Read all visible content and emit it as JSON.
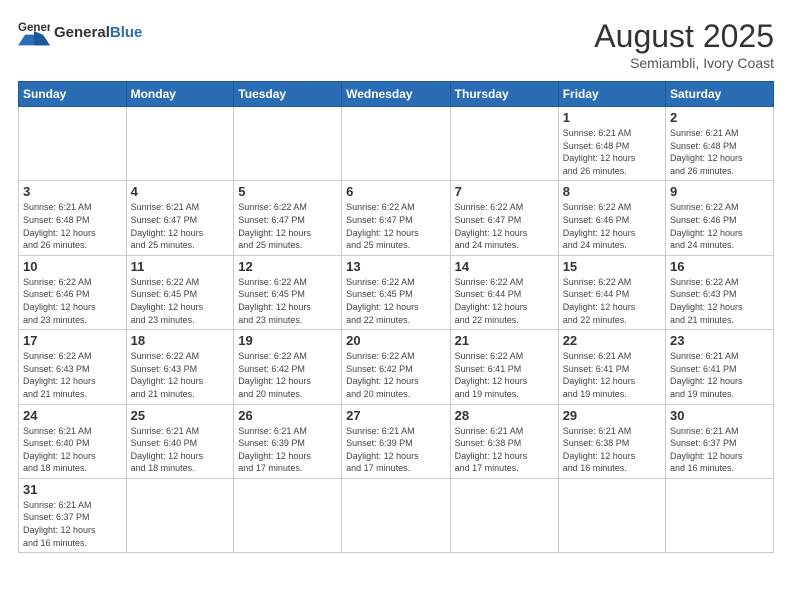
{
  "header": {
    "logo_general": "General",
    "logo_blue": "Blue",
    "month_title": "August 2025",
    "subtitle": "Semiambli, Ivory Coast"
  },
  "weekdays": [
    "Sunday",
    "Monday",
    "Tuesday",
    "Wednesday",
    "Thursday",
    "Friday",
    "Saturday"
  ],
  "days": {
    "1": {
      "sunrise": "6:21 AM",
      "sunset": "6:48 PM",
      "daylight": "12 hours and 26 minutes."
    },
    "2": {
      "sunrise": "6:21 AM",
      "sunset": "6:48 PM",
      "daylight": "12 hours and 26 minutes."
    },
    "3": {
      "sunrise": "6:21 AM",
      "sunset": "6:48 PM",
      "daylight": "12 hours and 26 minutes."
    },
    "4": {
      "sunrise": "6:21 AM",
      "sunset": "6:47 PM",
      "daylight": "12 hours and 25 minutes."
    },
    "5": {
      "sunrise": "6:22 AM",
      "sunset": "6:47 PM",
      "daylight": "12 hours and 25 minutes."
    },
    "6": {
      "sunrise": "6:22 AM",
      "sunset": "6:47 PM",
      "daylight": "12 hours and 25 minutes."
    },
    "7": {
      "sunrise": "6:22 AM",
      "sunset": "6:47 PM",
      "daylight": "12 hours and 24 minutes."
    },
    "8": {
      "sunrise": "6:22 AM",
      "sunset": "6:46 PM",
      "daylight": "12 hours and 24 minutes."
    },
    "9": {
      "sunrise": "6:22 AM",
      "sunset": "6:46 PM",
      "daylight": "12 hours and 24 minutes."
    },
    "10": {
      "sunrise": "6:22 AM",
      "sunset": "6:46 PM",
      "daylight": "12 hours and 23 minutes."
    },
    "11": {
      "sunrise": "6:22 AM",
      "sunset": "6:45 PM",
      "daylight": "12 hours and 23 minutes."
    },
    "12": {
      "sunrise": "6:22 AM",
      "sunset": "6:45 PM",
      "daylight": "12 hours and 23 minutes."
    },
    "13": {
      "sunrise": "6:22 AM",
      "sunset": "6:45 PM",
      "daylight": "12 hours and 22 minutes."
    },
    "14": {
      "sunrise": "6:22 AM",
      "sunset": "6:44 PM",
      "daylight": "12 hours and 22 minutes."
    },
    "15": {
      "sunrise": "6:22 AM",
      "sunset": "6:44 PM",
      "daylight": "12 hours and 22 minutes."
    },
    "16": {
      "sunrise": "6:22 AM",
      "sunset": "6:43 PM",
      "daylight": "12 hours and 21 minutes."
    },
    "17": {
      "sunrise": "6:22 AM",
      "sunset": "6:43 PM",
      "daylight": "12 hours and 21 minutes."
    },
    "18": {
      "sunrise": "6:22 AM",
      "sunset": "6:43 PM",
      "daylight": "12 hours and 21 minutes."
    },
    "19": {
      "sunrise": "6:22 AM",
      "sunset": "6:42 PM",
      "daylight": "12 hours and 20 minutes."
    },
    "20": {
      "sunrise": "6:22 AM",
      "sunset": "6:42 PM",
      "daylight": "12 hours and 20 minutes."
    },
    "21": {
      "sunrise": "6:22 AM",
      "sunset": "6:41 PM",
      "daylight": "12 hours and 19 minutes."
    },
    "22": {
      "sunrise": "6:21 AM",
      "sunset": "6:41 PM",
      "daylight": "12 hours and 19 minutes."
    },
    "23": {
      "sunrise": "6:21 AM",
      "sunset": "6:41 PM",
      "daylight": "12 hours and 19 minutes."
    },
    "24": {
      "sunrise": "6:21 AM",
      "sunset": "6:40 PM",
      "daylight": "12 hours and 18 minutes."
    },
    "25": {
      "sunrise": "6:21 AM",
      "sunset": "6:40 PM",
      "daylight": "12 hours and 18 minutes."
    },
    "26": {
      "sunrise": "6:21 AM",
      "sunset": "6:39 PM",
      "daylight": "12 hours and 17 minutes."
    },
    "27": {
      "sunrise": "6:21 AM",
      "sunset": "6:39 PM",
      "daylight": "12 hours and 17 minutes."
    },
    "28": {
      "sunrise": "6:21 AM",
      "sunset": "6:38 PM",
      "daylight": "12 hours and 17 minutes."
    },
    "29": {
      "sunrise": "6:21 AM",
      "sunset": "6:38 PM",
      "daylight": "12 hours and 16 minutes."
    },
    "30": {
      "sunrise": "6:21 AM",
      "sunset": "6:37 PM",
      "daylight": "12 hours and 16 minutes."
    },
    "31": {
      "sunrise": "6:21 AM",
      "sunset": "6:37 PM",
      "daylight": "12 hours and 16 minutes."
    }
  }
}
